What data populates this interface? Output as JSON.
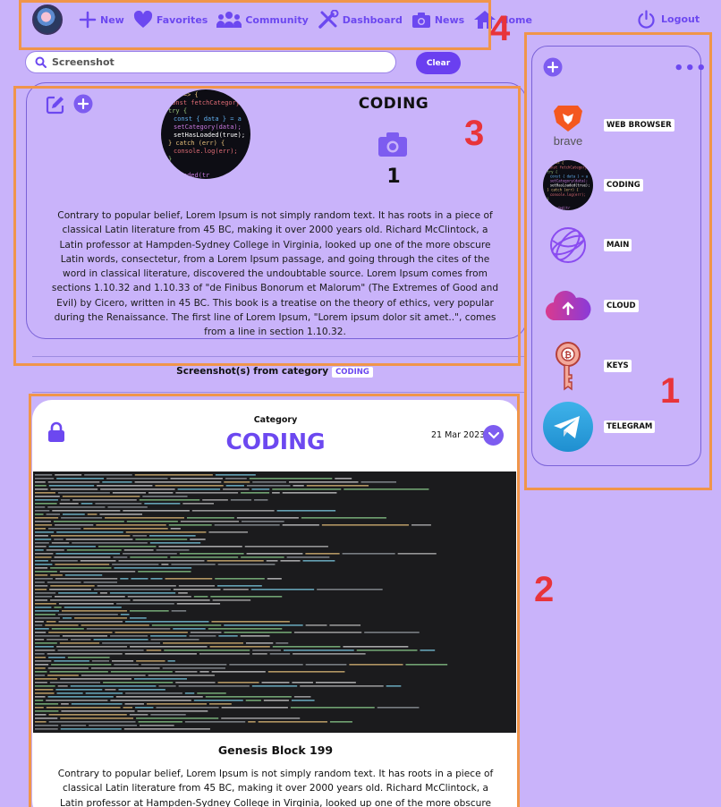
{
  "nav": {
    "items": [
      {
        "label": "New",
        "icon": "plus-icon"
      },
      {
        "label": "Favorites",
        "icon": "heart-icon"
      },
      {
        "label": "Community",
        "icon": "users-icon"
      },
      {
        "label": "Dashboard",
        "icon": "tools-icon"
      },
      {
        "label": "News",
        "icon": "camera-icon"
      },
      {
        "label": "Home",
        "icon": "home-icon"
      }
    ],
    "logout": "Logout"
  },
  "search": {
    "placeholder": "Screenshot",
    "clear_label": "Clear"
  },
  "category": {
    "title": "CODING",
    "count": "1",
    "description": "Contrary to popular belief, Lorem Ipsum is not simply random text. It has roots in a piece of classical Latin literature from 45 BC, making it over 2000 years old. Richard McClintock, a Latin professor at Hampden-Sydney College in Virginia, looked up one of the more obscure Latin words, consectetur, from a Lorem Ipsum passage, and going through the cites of the word in classical literature, discovered the undoubtable source. Lorem Ipsum comes from sections 1.10.32 and 1.10.33 of \"de Finibus Bonorum et Malorum\" (The Extremes of Good and Evil) by Cicero, written in 45 BC. This book is a treatise on the theory of ethics, very popular during the Renaissance. The first line of Lorem Ipsum, \"Lorem ipsum dolor sit amet..\", comes from a line in section 1.10.32.",
    "code_lines": [
      "(() => {",
      "const fetchCategory",
      "try {",
      "  const { data } = a",
      "  setCategory(data);",
      "  setHasLoaded(true);",
      "} catch (err) {",
      "  console.log(err);",
      "}",
      "",
      "asLoaded(tr"
    ]
  },
  "from_category": {
    "text": "Screenshot(s) from category",
    "tag": "CODING"
  },
  "screenshot": {
    "category_label": "Category",
    "category": "CODING",
    "date": "21 Mar 2023",
    "name": "Genesis Block 199",
    "description": "Contrary to popular belief, Lorem Ipsum is not simply random text. It has roots in a piece of classical Latin literature from 45 BC, making it over 2000 years old. Richard McClintock, a Latin professor at Hampden-Sydney College in Virginia, looked up one of the more obscure Latin words, consectetur, from"
  },
  "sidebar": {
    "more": "•••",
    "items": [
      {
        "label": "WEB BROWSER",
        "icon": "brave-icon",
        "icon_text": "brave"
      },
      {
        "label": "CODING",
        "icon": "code-thumbnail-icon"
      },
      {
        "label": "MAIN",
        "icon": "globe-icon"
      },
      {
        "label": "CLOUD",
        "icon": "cloud-upload-icon"
      },
      {
        "label": "KEYS",
        "icon": "key-icon"
      },
      {
        "label": "TELEGRAM",
        "icon": "telegram-icon"
      }
    ]
  },
  "annotations": [
    "1",
    "2",
    "3",
    "4"
  ],
  "colors": {
    "background": "#c9b3fa",
    "accent": "#6c48f0",
    "annotation_box": "#f0954a",
    "annotation_number": "#e8343a"
  }
}
